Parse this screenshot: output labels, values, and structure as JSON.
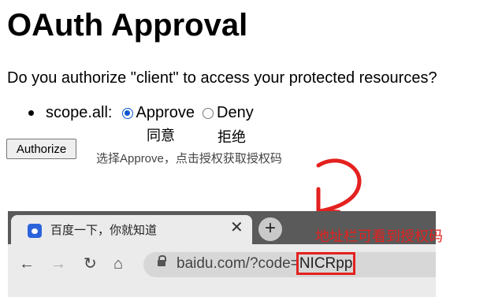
{
  "page": {
    "title": "OAuth Approval",
    "question": "Do you authorize \"client\" to access your protected resources?",
    "scope_label": "scope.all:",
    "approve_label": "Approve",
    "deny_label": "Deny",
    "approve_cn": "同意",
    "deny_cn": "拒绝",
    "authorize_button": "Authorize",
    "hint": "选择Approve，点击授权获取授权码",
    "approve_checked": true
  },
  "browser": {
    "tab_title": "百度一下，你就知道",
    "close_glyph": "✕",
    "newtab_glyph": "+",
    "back_glyph": "←",
    "forward_glyph": "→",
    "reload_glyph": "↻",
    "home_glyph": "⌂",
    "url_prefix": "baidu.com/?code=",
    "url_code": "NICRpp"
  },
  "annotation": {
    "text": "地址栏可看到授权码",
    "color": "#e3211f"
  }
}
